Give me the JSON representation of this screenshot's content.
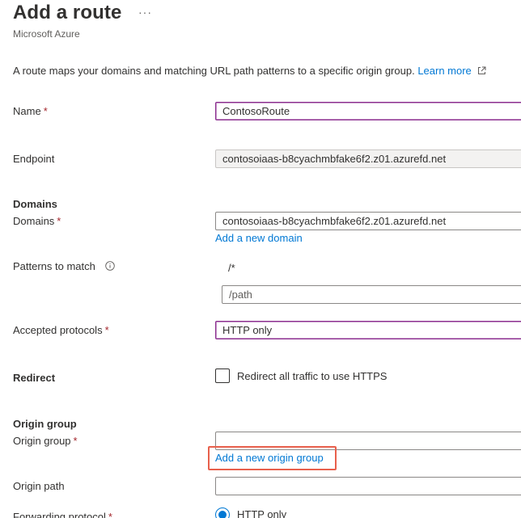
{
  "header": {
    "title": "Add a route",
    "more": "···",
    "subtitle": "Microsoft Azure"
  },
  "description": {
    "text": "A route maps your domains and matching URL path patterns to a specific origin group.",
    "link": "Learn more",
    "link_icon": "external-link-icon"
  },
  "form": {
    "name": {
      "label": "Name",
      "required": "*",
      "value": "ContosoRoute"
    },
    "endpoint": {
      "label": "Endpoint",
      "value": "contosoiaas-b8cyachmbfake6f2.z01.azurefd.net"
    },
    "domains_section": "Domains",
    "domains": {
      "label": "Domains",
      "required": "*",
      "value": "contosoiaas-b8cyachmbfake6f2.z01.azurefd.net",
      "add_link": "Add a new domain"
    },
    "patterns": {
      "label": "Patterns to match",
      "info_icon": "info-icon",
      "value": "/*",
      "placeholder": "/path"
    },
    "protocols": {
      "label": "Accepted protocols",
      "required": "*",
      "value": "HTTP only"
    },
    "redirect": {
      "label": "Redirect",
      "checkbox_label": "Redirect all traffic to use HTTPS",
      "checked": false
    },
    "origin_group_section": "Origin group",
    "origin_group": {
      "label": "Origin group",
      "required": "*",
      "value": "",
      "add_link": "Add a new origin group"
    },
    "origin_path": {
      "label": "Origin path",
      "value": ""
    },
    "forwarding": {
      "label": "Forwarding protocol",
      "required": "*",
      "option": "HTTP only",
      "selected": true
    }
  },
  "colors": {
    "link": "#0078d4",
    "required": "#a4262c",
    "focus_border": "#8b2e8f",
    "highlight": "#e8604c"
  }
}
